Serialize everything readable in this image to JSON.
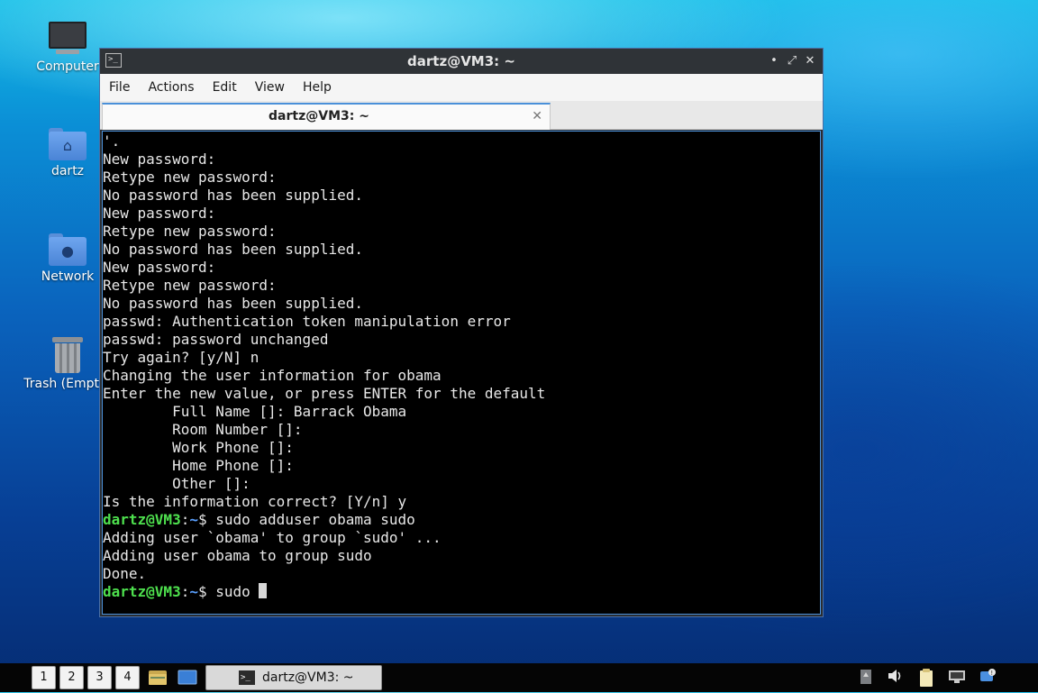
{
  "desktop": {
    "icons": [
      {
        "label": "Computer",
        "icon": "computer-icon"
      },
      {
        "label": "dartz",
        "icon": "home-folder-icon"
      },
      {
        "label": "Network",
        "icon": "network-folder-icon"
      },
      {
        "label": "Trash (Empty)",
        "icon": "trash-icon"
      }
    ]
  },
  "window": {
    "title": "dartz@VM3: ~",
    "controls": {
      "minimize": "•",
      "maximize": "⤢",
      "close": "✕"
    },
    "menu": [
      "File",
      "Actions",
      "Edit",
      "View",
      "Help"
    ],
    "tab": {
      "label": "dartz@VM3: ~",
      "close": "✕"
    },
    "terminal": {
      "lines": [
        "'.",
        "New password:",
        "Retype new password:",
        "No password has been supplied.",
        "New password:",
        "Retype new password:",
        "No password has been supplied.",
        "New password:",
        "Retype new password:",
        "No password has been supplied.",
        "passwd: Authentication token manipulation error",
        "passwd: password unchanged",
        "Try again? [y/N] n",
        "Changing the user information for obama",
        "Enter the new value, or press ENTER for the default",
        "        Full Name []: Barrack Obama",
        "        Room Number []:",
        "        Work Phone []:",
        "        Home Phone []:",
        "        Other []:",
        "Is the information correct? [Y/n] y"
      ],
      "prompt1": {
        "user": "dartz@VM3",
        "sep": ":",
        "path": "~",
        "symbol": "$ ",
        "command": "sudo adduser obama sudo"
      },
      "output2": [
        "Adding user `obama' to group `sudo' ...",
        "Adding user obama to group sudo",
        "Done."
      ],
      "prompt2": {
        "user": "dartz@VM3",
        "sep": ":",
        "path": "~",
        "symbol": "$ ",
        "command": "sudo "
      }
    }
  },
  "taskbar": {
    "workspaces": [
      "1",
      "2",
      "3",
      "4"
    ],
    "launchers": [
      "file-manager-icon",
      "show-desktop-icon"
    ],
    "task": {
      "label": "dartz@VM3: ~",
      "icon": "terminal-icon"
    },
    "tray": [
      "disk-icon",
      "volume-icon",
      "clipboard-icon",
      "network-icon",
      "notification-icon"
    ]
  }
}
